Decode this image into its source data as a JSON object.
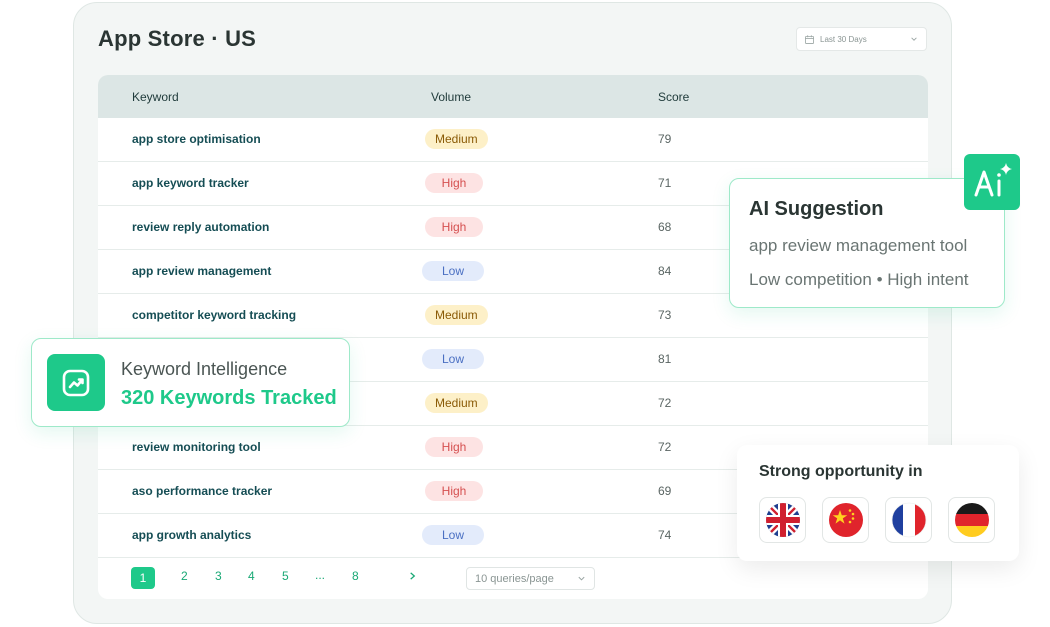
{
  "header": {
    "title": "App Store · US",
    "date_range": "Last 30 Days"
  },
  "table": {
    "columns": [
      "Keyword",
      "Volume",
      "Score"
    ],
    "rows": [
      {
        "keyword": "app store optimisation",
        "volume": "Medium",
        "score": "79"
      },
      {
        "keyword": "app keyword tracker",
        "volume": "High",
        "score": "71"
      },
      {
        "keyword": "review reply automation",
        "volume": "High",
        "score": "68"
      },
      {
        "keyword": "app review management",
        "volume": "Low",
        "score": "84"
      },
      {
        "keyword": "competitor keyword tracking",
        "volume": "Medium",
        "score": "73"
      },
      {
        "keyword": "",
        "volume": "Low",
        "score": "81"
      },
      {
        "keyword": "",
        "volume": "Medium",
        "score": "72"
      },
      {
        "keyword": "review monitoring tool",
        "volume": "High",
        "score": "72"
      },
      {
        "keyword": "aso performance tracker",
        "volume": "High",
        "score": "69"
      },
      {
        "keyword": "app growth analytics",
        "volume": "Low",
        "score": "74"
      }
    ]
  },
  "pagination": {
    "pages": [
      "1",
      "2",
      "3",
      "4",
      "5",
      "...",
      "8"
    ],
    "current": "1",
    "per_page": "10 queries/page"
  },
  "keyword_intelligence": {
    "title": "Keyword Intelligence",
    "value": "320 Keywords Tracked"
  },
  "ai_suggestion": {
    "title": "AI Suggestion",
    "keyword": "app review management tool",
    "detail": "Low competition • High intent",
    "badge_icon": "ai-sparkle-icon"
  },
  "opportunity": {
    "title": "Strong opportunity in",
    "flags": [
      "uk-flag-icon",
      "china-flag-icon",
      "france-flag-icon",
      "germany-flag-icon"
    ]
  },
  "colors": {
    "accent": "#1ec98a",
    "keyword_text": "#154d54",
    "header_bg": "#dce6e5"
  }
}
